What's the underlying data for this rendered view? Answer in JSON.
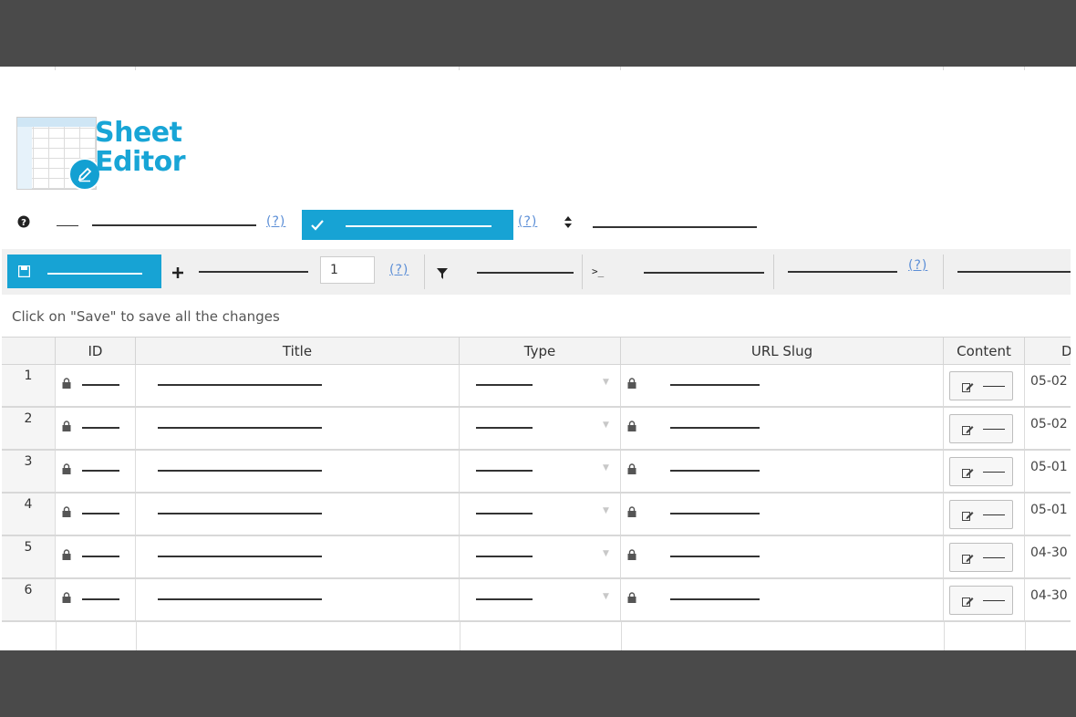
{
  "app": {
    "logo_line1": "Sheet",
    "logo_line2": "Editor",
    "brand_color": "#17a3d4"
  },
  "toolbar1": {
    "help_icon": "question-circle-icon",
    "check_icon": "check-icon",
    "sort_icon": "sort-icon",
    "help_link_1": "(?)",
    "help_link_2": "(?)"
  },
  "toolbar2": {
    "save_icon": "floppy-disk-icon",
    "add_icon": "plus-icon",
    "add_count": "1",
    "help_link_1": "(?)",
    "filter_icon": "filter-icon",
    "formula_icon": "terminal-icon",
    "help_link_2": "(?)"
  },
  "hint": "Click on \"Save\" to save all the changes",
  "table": {
    "columns": [
      "",
      "ID",
      "Title",
      "Type",
      "URL Slug",
      "Content",
      "D"
    ],
    "rows": [
      {
        "num": "1",
        "date": "05-02"
      },
      {
        "num": "2",
        "date": "05-02"
      },
      {
        "num": "3",
        "date": "05-01"
      },
      {
        "num": "4",
        "date": "05-01"
      },
      {
        "num": "5",
        "date": "04-30"
      },
      {
        "num": "6",
        "date": "04-30"
      }
    ]
  }
}
